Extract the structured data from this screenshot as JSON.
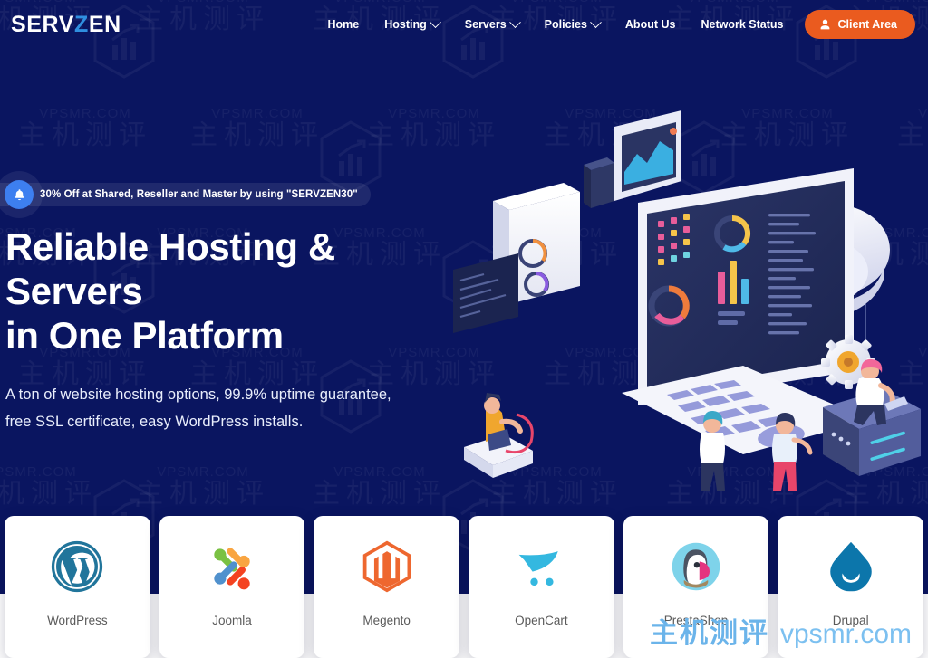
{
  "brand": {
    "part1": "SERV",
    "accent": "Z",
    "part2": "EN",
    "accent_color": "#2f8fe0"
  },
  "nav": {
    "items": [
      {
        "label": "Home",
        "has_dropdown": false
      },
      {
        "label": "Hosting",
        "has_dropdown": true
      },
      {
        "label": "Servers",
        "has_dropdown": true
      },
      {
        "label": "Policies",
        "has_dropdown": true
      },
      {
        "label": "About Us",
        "has_dropdown": false
      },
      {
        "label": "Network Status",
        "has_dropdown": false
      }
    ],
    "cta": {
      "label": "Client Area",
      "icon": "user-icon",
      "bg_color": "#ea5b1f",
      "text_color": "#ffffff"
    }
  },
  "promo": {
    "icon": "bell-icon",
    "icon_bg": "#3d7ff0",
    "text": "30% Off at Shared, Reseller and Master by using \"SERVZEN30\""
  },
  "hero": {
    "title_line1": "Reliable Hosting & Servers",
    "title_line2": "in One Platform",
    "sub_line1": "A ton of website hosting options, 99.9% uptime guarantee,",
    "sub_line2": "free SSL certificate, easy WordPress installs.",
    "bg_color": "#0a1560",
    "illustration": "isometric-hosting-illustration"
  },
  "apps": {
    "cards": [
      {
        "label": "WordPress",
        "icon": "wordpress-icon",
        "color": "#21759b"
      },
      {
        "label": "Joomla",
        "icon": "joomla-icon",
        "color": "#f44321"
      },
      {
        "label": "Megento",
        "icon": "magento-icon",
        "color": "#ee672f"
      },
      {
        "label": "OpenCart",
        "icon": "opencart-icon",
        "color": "#34b8e0"
      },
      {
        "label": "PrestaShop",
        "icon": "prestashop-icon",
        "color": "#7ed3ea"
      },
      {
        "label": "Drupal",
        "icon": "drupal-icon",
        "color": "#0c76ab"
      }
    ]
  },
  "watermark": {
    "tile_domain": "VPSMR.COM",
    "tile_cn": "主机测评",
    "bottom_cn": "主机测评",
    "bottom_url": "vpsmr.com",
    "bottom_color": "#7cc0f0"
  }
}
